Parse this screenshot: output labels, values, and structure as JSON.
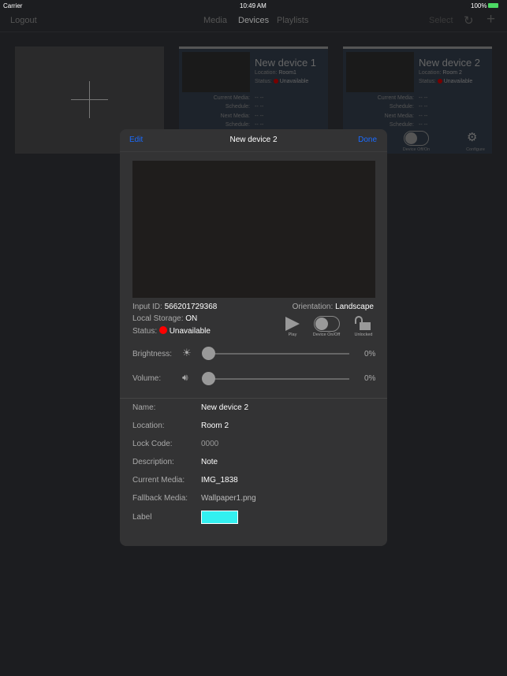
{
  "status_bar": {
    "carrier": "Carrier",
    "time": "10:49 AM",
    "battery": "100%"
  },
  "nav": {
    "logout": "Logout",
    "tabs": [
      "Media",
      "Devices",
      "Playlists"
    ],
    "active_tab": "Devices",
    "select": "Select"
  },
  "cards": [
    {
      "name": "New device 1",
      "location_label": "Location:",
      "location": "Room1",
      "status_label": "Status:",
      "status": "Unavailable",
      "current_media_label": "Current Media:",
      "current_media": "-- --",
      "schedule_label": "Schedule:",
      "schedule": "-- --",
      "next_media_label": "Next Media:",
      "next_media": "-- --",
      "next_schedule": "-- --"
    },
    {
      "name": "New device 2",
      "location_label": "Location:",
      "location": "Room 2",
      "status_label": "Status:",
      "status": "Unavailable",
      "current_media_label": "Current Media:",
      "current_media": "-- --",
      "schedule_label": "Schedule:",
      "schedule": "-- --",
      "next_media_label": "Next Media:",
      "next_media": "-- --",
      "next_schedule": "-- --",
      "toggle_label": "Device Off/On",
      "configure_label": "Configure"
    }
  ],
  "modal": {
    "edit": "Edit",
    "title": "New device 2",
    "done": "Done",
    "input_id_label": "Input ID:",
    "input_id": "566201729368",
    "storage_label": "Local Storage:",
    "storage": "ON",
    "status_label": "Status:",
    "status": "Unavailable",
    "orientation_label": "Orientation:",
    "orientation": "Landscape",
    "play": "Play",
    "device_toggle": "Device On/Off",
    "lock": "Unlocked",
    "brightness_label": "Brightness:",
    "brightness": "0%",
    "volume_label": "Volume:",
    "volume": "0%",
    "fields": [
      {
        "label": "Name:",
        "value": "New device 2"
      },
      {
        "label": "Location:",
        "value": "Room 2"
      },
      {
        "label": "Lock Code:",
        "value": "0000"
      },
      {
        "label": "Description:",
        "value": "Note"
      },
      {
        "label": "Current Media:",
        "value": "IMG_1838"
      },
      {
        "label": "Fallback Media:",
        "value": "Wallpaper1.png"
      }
    ],
    "label_label": "Label",
    "label_color": "#33f0f0"
  },
  "colors": {
    "accent": "#1a6bff",
    "status_red": "#ff0000"
  }
}
